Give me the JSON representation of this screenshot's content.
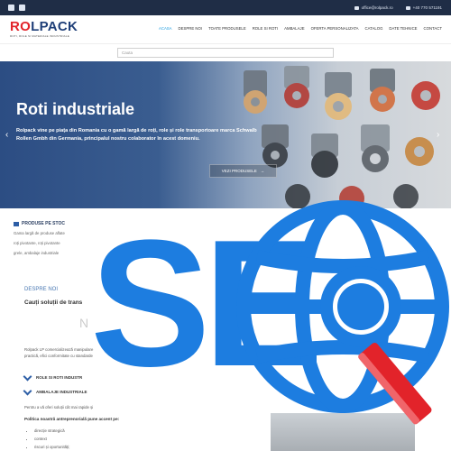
{
  "topbar": {
    "social": [
      "facebook-icon",
      "linkedin-icon"
    ],
    "email": "office@rolpack.ro",
    "phone": "+40 770 571191"
  },
  "header": {
    "logo_main_a": "R",
    "logo_main_o": "O",
    "logo_main_b": "L",
    "logo_main_c": "PACK",
    "logo_sub": "ROTI, ROLE SI MATERIALE INDUSTRIALE",
    "nav": [
      "ACASA",
      "DESPRE NOI",
      "TOATE PRODUSELE",
      "ROLE SI ROTI",
      "AMBALAJE",
      "OFERTA PERSONALIZATA",
      "CATALOG",
      "DATE TEHNICE",
      "CONTACT"
    ]
  },
  "search": {
    "placeholder": "Cauta"
  },
  "hero": {
    "title": "Roti industriale",
    "text": "Rolpack vine pe piața din Romania cu o gamă largă de roți, role și role transportoare marca Schwalb Rollen Gmbh din Germania, principalul nostru colaborator în acest domeniu.",
    "button": "VEZI PRODUSELE"
  },
  "produse": {
    "title": "PRODUSE PE STOC",
    "lines": [
      "Gama largă de produse aflate",
      "roți pivotante, roți pivotante",
      "grele, ambalaje industriale"
    ]
  },
  "despre": {
    "label": "DESPRE NOI",
    "title": "Cauți soluții de trans",
    "big": "N",
    "para": "Rolpack LP comercializează manipulare practică, efici conformitate cu standarde",
    "check1": "ROLE SI ROTI INDUSTR",
    "check2": "AMBALAJE INDUSTRIALE",
    "para2": "Pentru a vă oferi soluții cât mai rapide și",
    "policy": "Politica noastră antreprenorială pune accent pe:",
    "bullets": [
      "direcție strategică",
      "context",
      "riscuri și oportunități;"
    ]
  },
  "overlay": {
    "text": "SE"
  },
  "colors": {
    "topbar": "#1f2d46",
    "seo_blue": "#1d7de0",
    "magnifier_red": "#e2232a"
  }
}
